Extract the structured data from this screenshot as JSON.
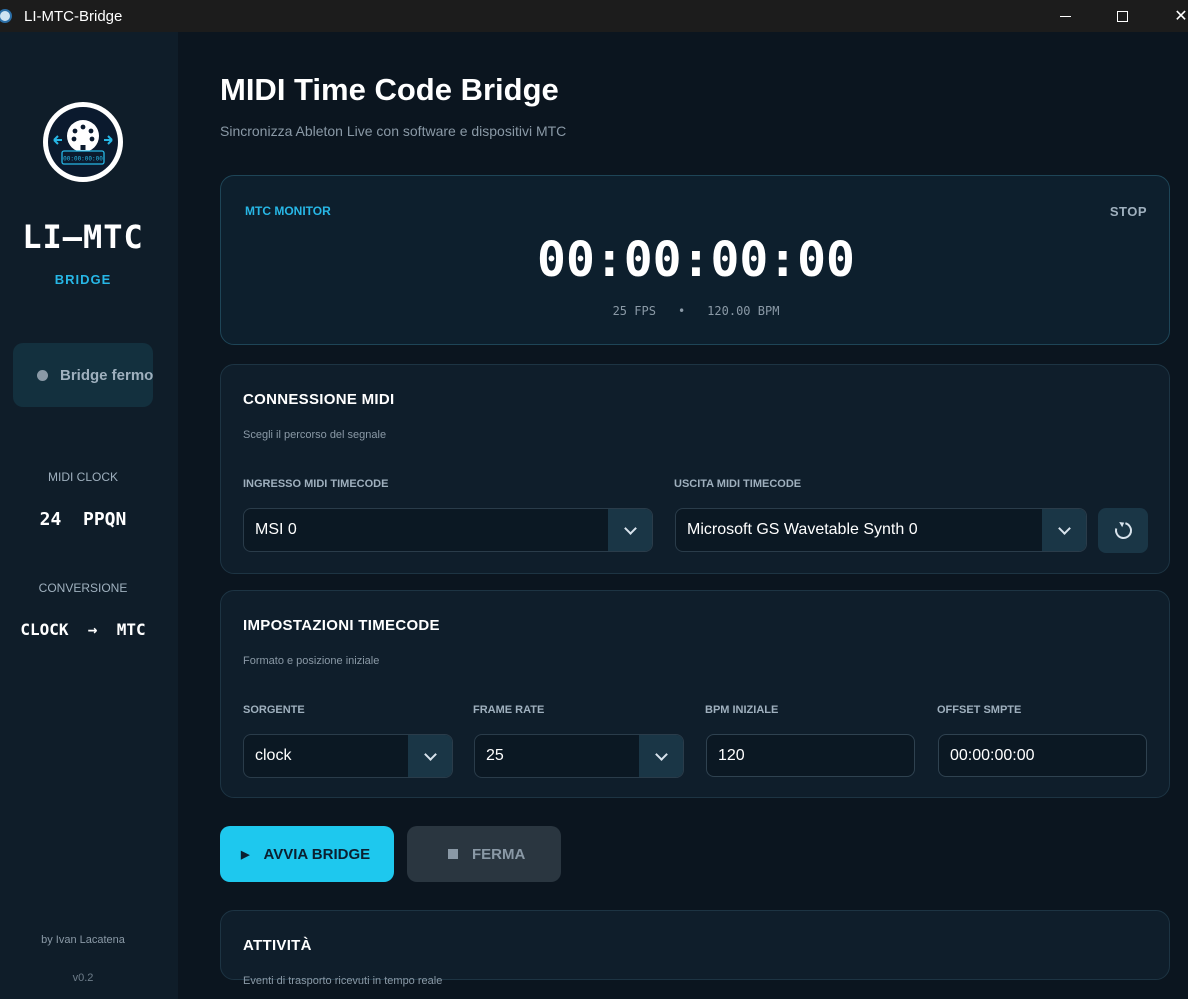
{
  "window": {
    "title": "LI-MTC-Bridge"
  },
  "sidebar": {
    "brand": "LI–MTC",
    "brand_sub": "BRIDGE",
    "status": "Bridge fermo",
    "clock_label": "MIDI CLOCK",
    "clock_value": "24  PPQN",
    "conversion_label": "CONVERSIONE",
    "conversion_value": "CLOCK  →  MTC",
    "author": "by Ivan Lacatena",
    "version": "v0.2",
    "logo_display": "00:00:00:00"
  },
  "header": {
    "title": "MIDI Time Code Bridge",
    "subtitle": "Sincronizza Ableton Live con software e dispositivi MTC"
  },
  "monitor": {
    "label": "MTC MONITOR",
    "state": "STOP",
    "timecode": "00:00:00:00",
    "fps": "25 FPS",
    "separator": "•",
    "bpm": "120.00 BPM"
  },
  "midi_connection": {
    "title": "CONNESSIONE MIDI",
    "subtitle": "Scegli il percorso del segnale",
    "input_label": "INGRESSO MIDI TIMECODE",
    "input_value": "MSI 0",
    "output_label": "USCITA MIDI TIMECODE",
    "output_value": "Microsoft GS Wavetable Synth 0"
  },
  "timecode_settings": {
    "title": "IMPOSTAZIONI TIMECODE",
    "subtitle": "Formato e posizione iniziale",
    "source_label": "SORGENTE",
    "source_value": "clock",
    "framerate_label": "FRAME RATE",
    "framerate_value": "25",
    "bpm_label": "BPM INIZIALE",
    "bpm_value": "120",
    "offset_label": "OFFSET SMPTE",
    "offset_value": "00:00:00:00"
  },
  "actions": {
    "start_label": "AVVIA BRIDGE",
    "stop_label": "FERMA"
  },
  "activity": {
    "title": "ATTIVITÀ",
    "subtitle": "Eventi di trasporto ricevuti in tempo reale"
  },
  "colors": {
    "accent": "#1ec8ee",
    "background": "#0b151f",
    "sidebar": "#0f1d29"
  }
}
